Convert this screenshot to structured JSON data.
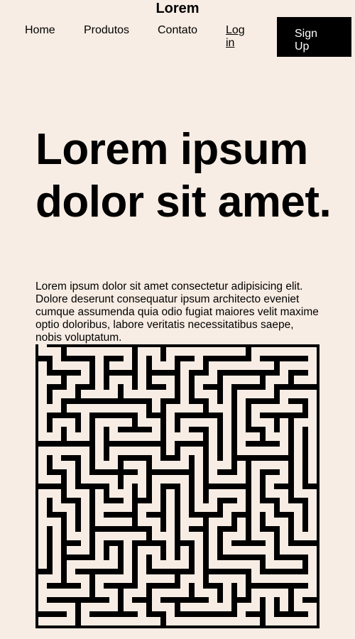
{
  "header": {
    "brand": "Lorem",
    "nav": {
      "home": "Home",
      "produtos": "Produtos",
      "contato": "Contato",
      "login": "Log in"
    },
    "signup_label": "Sign Up"
  },
  "hero": {
    "title": "Lorem ipsum dolor sit amet.",
    "text": "Lorem ipsum dolor sit amet consectetur adipisicing elit. Dolore deserunt consequatur ipsum architecto eveniet cumque assumenda quia odio fugiat maiores velit maxime optio doloribus, labore veritatis necessitatibus saepe, nobis voluptatum."
  },
  "maze": {
    "image_name": "maze-illustration",
    "wall_color": "#000000",
    "path_color": "#f8ede4"
  },
  "colors": {
    "background": "#f8ede4",
    "button_bg": "#000000",
    "button_text": "#ffffff"
  }
}
